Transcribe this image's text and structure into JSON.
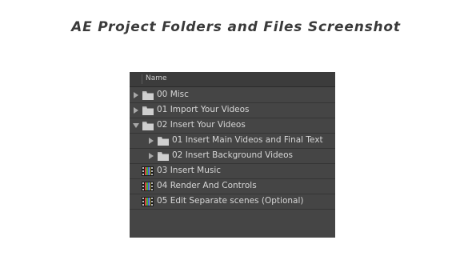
{
  "page": {
    "title": "AE Project Folders and Files Screenshot"
  },
  "panel": {
    "header_label": "Name",
    "items": [
      {
        "label": "00 Misc",
        "type": "folder",
        "state": "collapsed",
        "level": 0
      },
      {
        "label": "01 Import Your Videos",
        "type": "folder",
        "state": "collapsed",
        "level": 0
      },
      {
        "label": "02 Insert Your Videos",
        "type": "folder",
        "state": "expanded",
        "level": 0
      },
      {
        "label": "01 Insert Main Videos and Final Text",
        "type": "folder",
        "state": "collapsed",
        "level": 1
      },
      {
        "label": "02 Insert Background Videos",
        "type": "folder",
        "state": "collapsed",
        "level": 1
      },
      {
        "label": "03 Insert Music",
        "type": "composition",
        "level": 0
      },
      {
        "label": "04 Render And Controls",
        "type": "composition",
        "level": 0
      },
      {
        "label": "05 Edit Separate scenes (Optional)",
        "type": "composition",
        "level": 0
      }
    ]
  },
  "colors": {
    "panel_bg": "#454545",
    "header_bg": "#3c3c3c",
    "row_divider": "#353535",
    "text": "#d6d6d6",
    "folder": "#cfcfcf"
  }
}
